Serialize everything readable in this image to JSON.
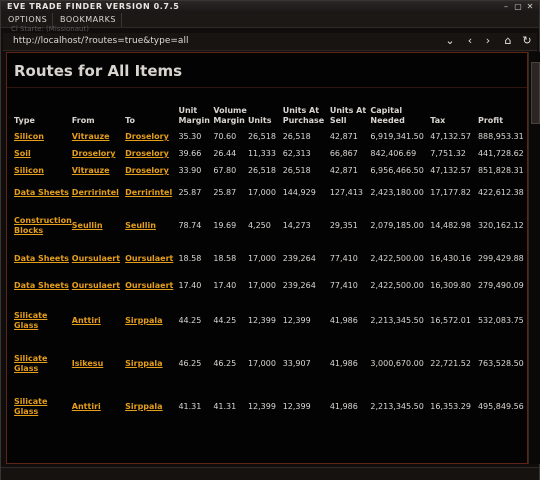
{
  "window": {
    "title": "EVE TRADE FINDER VERSION 0.7.5",
    "ghost_text": "Cl Starte: (Missionaut)",
    "controls": [
      "–",
      "▢",
      "✕"
    ]
  },
  "menu": [
    "OPTIONS",
    "BOOKMARKS"
  ],
  "address": {
    "url": "http://localhost/?routes=true&type=all",
    "toolbar_icons": [
      "chevron-down-icon",
      "back-icon",
      "forward-icon",
      "home-icon",
      "refresh-icon"
    ]
  },
  "page": {
    "title": "Routes for All Items"
  },
  "table": {
    "headers": [
      "Type",
      "From",
      "To",
      "Unit Margin",
      "Volume Margin",
      "Units",
      "Units At Purchase",
      "Units At Sell",
      "Capital Needed",
      "Tax",
      "Profit"
    ],
    "rows": [
      {
        "type": "Silicon",
        "from": "Vitrauze",
        "to": "Droselory",
        "unit_margin": "35.30",
        "volume_margin": "70.60",
        "units": "26,518",
        "purchase": "26,518",
        "sell": "42,871",
        "capital": "6,919,341.50",
        "tax": "47,132.57",
        "profit": "888,953.31"
      },
      {
        "type": "Soil",
        "from": "Droselory",
        "to": "Droselory",
        "unit_margin": "39.66",
        "volume_margin": "26.44",
        "units": "11,333",
        "purchase": "62,313",
        "sell": "66,867",
        "capital": "842,406.69",
        "tax": "7,751.32",
        "profit": "441,728.62"
      },
      {
        "type": "Silicon",
        "from": "Vitrauze",
        "to": "Droselory",
        "unit_margin": "33.90",
        "volume_margin": "67.80",
        "units": "26,518",
        "purchase": "26,518",
        "sell": "42,871",
        "capital": "6,956,466.50",
        "tax": "47,132.57",
        "profit": "851,828.31"
      },
      {
        "type": "Data Sheets",
        "from": "Derririntel",
        "to": "Derririntel",
        "unit_margin": "25.87",
        "volume_margin": "25.87",
        "units": "17,000",
        "purchase": "144,929",
        "sell": "127,413",
        "capital": "2,423,180.00",
        "tax": "17,177.82",
        "profit": "422,612.38"
      },
      {
        "type": "Construction Blocks",
        "from": "Seullin",
        "to": "Seullin",
        "unit_margin": "78.74",
        "volume_margin": "19.69",
        "units": "4,250",
        "purchase": "14,273",
        "sell": "29,351",
        "capital": "2,079,185.00",
        "tax": "14,482.98",
        "profit": "320,162.12"
      },
      {
        "type": "Data Sheets",
        "from": "Oursulaert",
        "to": "Oursulaert",
        "unit_margin": "18.58",
        "volume_margin": "18.58",
        "units": "17,000",
        "purchase": "239,264",
        "sell": "77,410",
        "capital": "2,422,500.00",
        "tax": "16,430.16",
        "profit": "299,429.88"
      },
      {
        "type": "Data Sheets",
        "from": "Oursulaert",
        "to": "Oursulaert",
        "unit_margin": "17.40",
        "volume_margin": "17.40",
        "units": "17,000",
        "purchase": "239,264",
        "sell": "77,410",
        "capital": "2,422,500.00",
        "tax": "16,309.80",
        "profit": "279,490.09"
      },
      {
        "type": "Silicate Glass",
        "from": "Anttiri",
        "to": "Sirppala",
        "unit_margin": "44.25",
        "volume_margin": "44.25",
        "units": "12,399",
        "purchase": "12,399",
        "sell": "41,986",
        "capital": "2,213,345.50",
        "tax": "16,572.01",
        "profit": "532,083.75"
      },
      {
        "type": "Silicate Glass",
        "from": "Isikesu",
        "to": "Sirppala",
        "unit_margin": "46.25",
        "volume_margin": "46.25",
        "units": "17,000",
        "purchase": "33,907",
        "sell": "41,986",
        "capital": "3,000,670.00",
        "tax": "22,721.52",
        "profit": "763,528.50"
      },
      {
        "type": "Silicate Glass",
        "from": "Anttiri",
        "to": "Sirppala",
        "unit_margin": "41.31",
        "volume_margin": "41.31",
        "units": "12,399",
        "purchase": "12,399",
        "sell": "41,986",
        "capital": "2,213,345.50",
        "tax": "16,353.29",
        "profit": "495,849.56"
      }
    ]
  },
  "colors": {
    "link": "#e49e1c",
    "frame_border": "#5e2514"
  }
}
